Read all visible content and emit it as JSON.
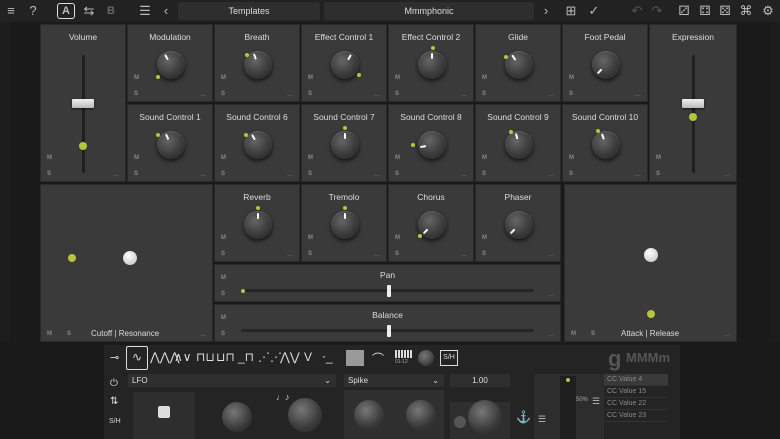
{
  "topbar": {
    "menu_icon": "menu-icon",
    "help": "?",
    "preset_a": "A",
    "preset_b": "B",
    "prev": "‹",
    "next": "›",
    "templates": "Templates",
    "preset_name": "Mmmphonic"
  },
  "tiles": {
    "volume": "Volume",
    "modulation": "Modulation",
    "breath": "Breath",
    "effect1": "Effect Control 1",
    "effect2": "Effect Control 2",
    "glide": "Glide",
    "foot_pedal": "Foot Pedal",
    "expression": "Expression",
    "sc1": "Sound Control 1",
    "sc6": "Sound Control 6",
    "sc7": "Sound Control 7",
    "sc8": "Sound Control 8",
    "sc9": "Sound Control 9",
    "sc10": "Sound Control 10",
    "reverb": "Reverb",
    "tremolo": "Tremolo",
    "chorus": "Chorus",
    "phaser": "Phaser",
    "pan": "Pan",
    "balance": "Balance",
    "cutoff": "Cutoff | Resonance",
    "attack": "Attack | Release",
    "m": "M",
    "s": "S",
    "dots": "..."
  },
  "lfo": {
    "source": "LFO",
    "shape": "Spike",
    "value": "1.00",
    "sh": "S/H",
    "range": "01-12",
    "brand": "MMMm",
    "list": [
      "CC Value 4",
      "CC Value 15",
      "CC Value 22",
      "CC Value 23"
    ],
    "percent": "50%"
  }
}
